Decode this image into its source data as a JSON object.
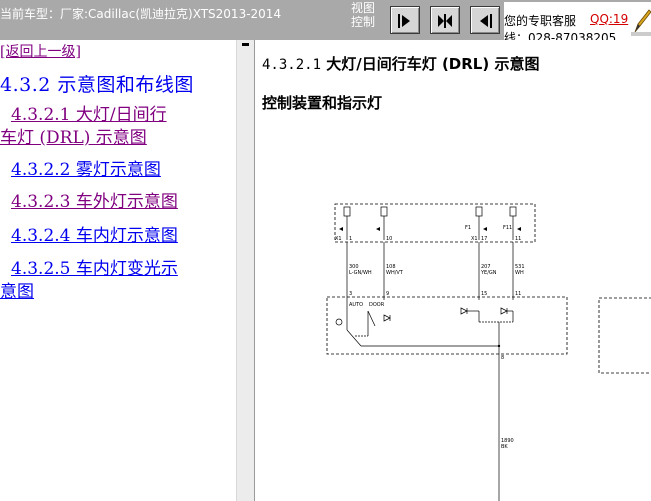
{
  "topbar": {
    "current_car": "当前车型：厂家:Cadillac(凯迪拉克)XTS2013-2014",
    "view_control_line1": "视图",
    "view_control_line2": "控制",
    "support_text": "您的专职客服",
    "qq_text": "QQ:19",
    "phone_text": "线：028-87038205"
  },
  "nav": {
    "back_link": "[返回上一级]",
    "heading": "4.3.2 示意图和布线图",
    "items": [
      {
        "line1": "4.3.2.1 大灯/日间行",
        "line2": "车灯 (DRL) 示意图",
        "visited": true
      },
      {
        "line1": "4.3.2.2 雾灯示意图",
        "line2": "",
        "visited": false
      },
      {
        "line1": "4.3.2.3 车外灯示意图",
        "line2": "",
        "visited": true
      },
      {
        "line1": "4.3.2.4 车内灯示意图",
        "line2": "",
        "visited": false
      },
      {
        "line1": "4.3.2.5 车内灯变光示",
        "line2": "意图",
        "visited": false
      }
    ]
  },
  "content": {
    "title_number": "4.3.2.1",
    "title_text": "大灯/日间行车灯 (DRL) 示意图",
    "subtitle": "控制装置和指示灯"
  },
  "diagram": {
    "connector": "X1",
    "pins": [
      "1",
      "10",
      "17",
      "11"
    ],
    "fuse_labels": [
      "F1",
      "F11"
    ],
    "wire_codes": [
      "300",
      "108",
      "207",
      "531",
      "1890"
    ],
    "wire_colors": [
      "L-GN/WH",
      "WH/VT",
      "YE/GN",
      "WH",
      "BK"
    ],
    "lower_pins": [
      "3",
      "9",
      "15",
      "11"
    ],
    "switch_labels": [
      "AUTO",
      "DOOR"
    ],
    "ground_pin": "8"
  }
}
